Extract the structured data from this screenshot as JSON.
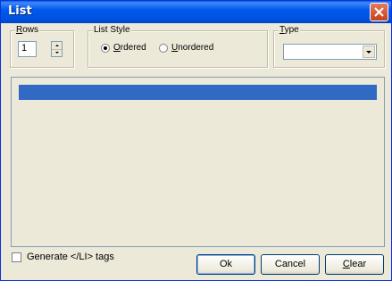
{
  "window": {
    "title": "List"
  },
  "rows": {
    "label_u": "R",
    "label_rest": "ows",
    "value": "1"
  },
  "list_style": {
    "label": "List Style",
    "ordered": {
      "label_u": "O",
      "label_rest": "rdered",
      "checked": true
    },
    "unordered": {
      "label_u": "U",
      "label_rest": "nordered",
      "checked": false
    }
  },
  "type": {
    "label_u": "T",
    "label_rest": "ype",
    "value": ""
  },
  "list_items": [
    {
      "text": "",
      "selected": true
    }
  ],
  "generate_li": {
    "label": "Generate </LI> tags",
    "checked": false
  },
  "buttons": {
    "ok": "Ok",
    "cancel": "Cancel",
    "clear_u": "C",
    "clear_rest": "lear"
  },
  "colors": {
    "titlebar": "#0058ee",
    "selection": "#316ac5",
    "face": "#ece9d8"
  }
}
